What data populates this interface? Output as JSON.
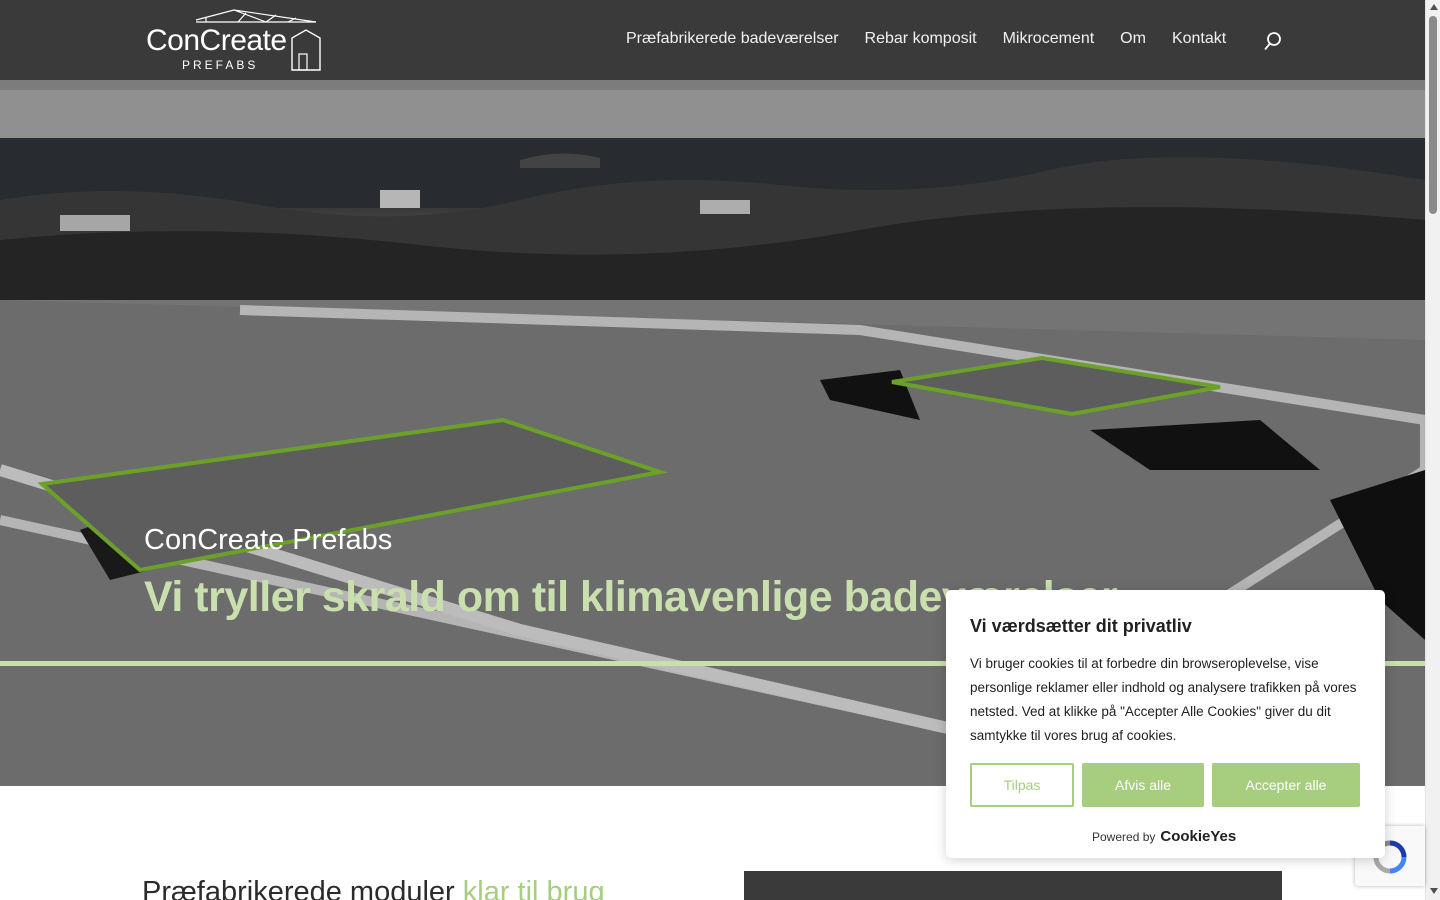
{
  "header": {
    "logo_main": "ConCreate",
    "logo_sub": "PREFABS",
    "nav": [
      {
        "label": "Præfabrikerede badeværelser"
      },
      {
        "label": "Rebar komposit"
      },
      {
        "label": "Mikrocement"
      },
      {
        "label": "Om"
      },
      {
        "label": "Kontakt"
      }
    ],
    "search_icon": "search-icon"
  },
  "hero": {
    "kicker": "ConCreate Prefabs",
    "title": "Vi tryller skrald om til klimavenlige badeværelser"
  },
  "section": {
    "title_main": "Præfabrikerede moduler ",
    "title_accent": "klar til brug"
  },
  "cookie": {
    "title": "Vi værdsætter dit privatliv",
    "text": "Vi bruger cookies til at forbedre din browseroplevelse, vise personlige reklamer eller indhold og analysere trafikken på vores netsted. Ved at klikke på \"Accepter Alle Cookies\" giver du dit samtykke til vores brug af cookies.",
    "customize": "Tilpas",
    "reject": "Afvis alle",
    "accept": "Accepter alle",
    "powered_by": "Powered by",
    "brand": "CookieYes"
  },
  "colors": {
    "accent": "#a7cd7e",
    "hero_title": "#c9dfae",
    "outline": "#7cb82f"
  }
}
